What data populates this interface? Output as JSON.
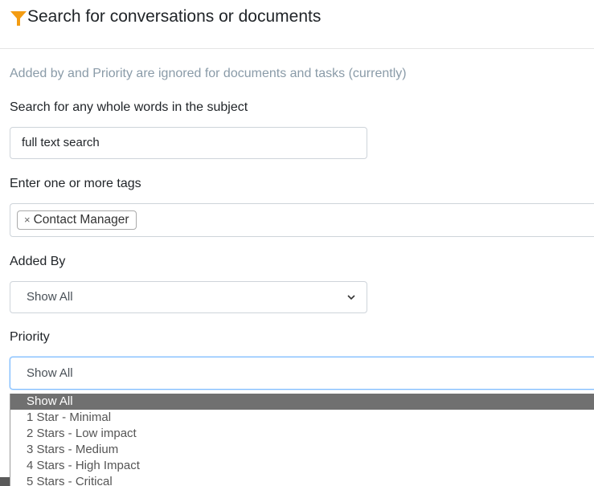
{
  "header": {
    "title": "Search for conversations or documents",
    "icon": "filter-icon",
    "icon_color": "#f39c12"
  },
  "note": "Added by and Priority are ignored for documents and tasks (currently)",
  "subject_search": {
    "label": "Search for any whole words in the subject",
    "value": "full text search"
  },
  "tags": {
    "label": "Enter one or more tags",
    "items": [
      {
        "remove": "×",
        "text": "Contact Manager"
      }
    ]
  },
  "added_by": {
    "label": "Added By",
    "selected": "Show All"
  },
  "priority": {
    "label": "Priority",
    "selected": "Show All",
    "options": [
      "Show All",
      "1 Star - Minimal",
      "2 Stars - Low impact",
      "3 Stars - Medium",
      "4 Stars - High Impact",
      "5 Stars - Critical"
    ],
    "highlighted_color": "#707070"
  }
}
